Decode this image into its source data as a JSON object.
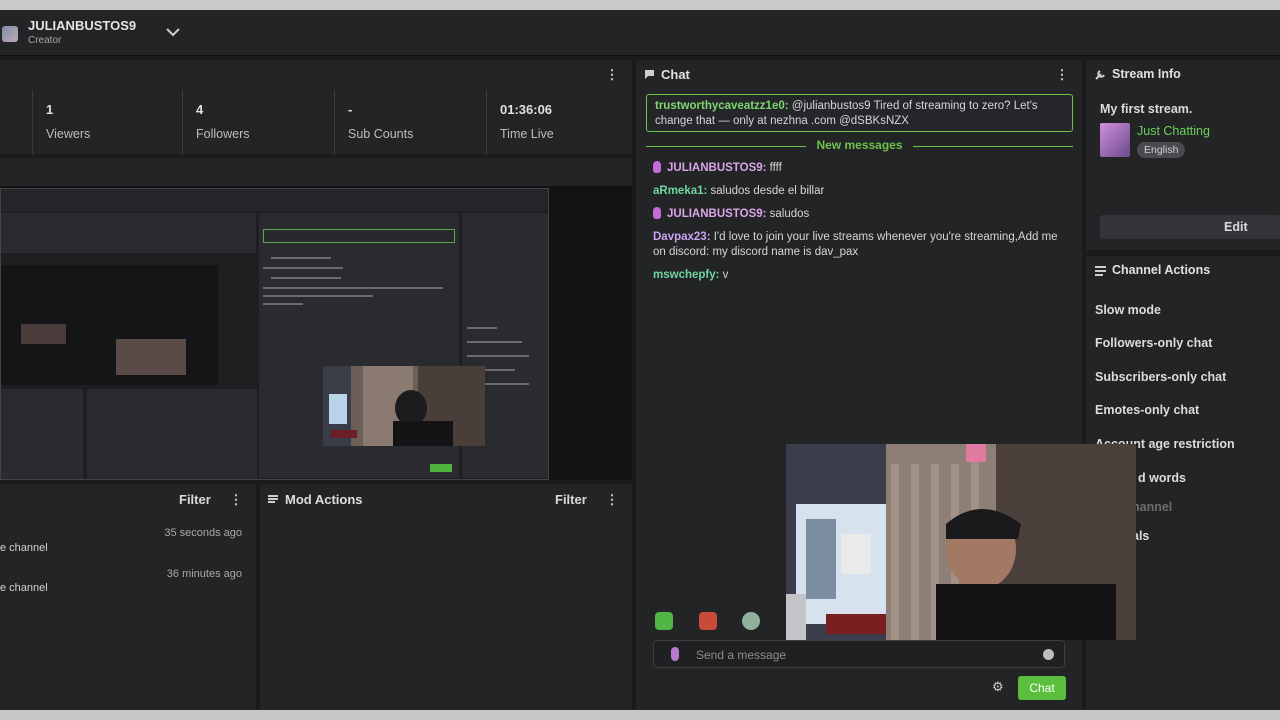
{
  "header": {
    "username": "JULIANBUSTOS9",
    "role": "Creator",
    "icons": {
      "avatar": "channel-avatar",
      "dropdown": "chevron-down-icon"
    }
  },
  "stats": [
    {
      "value": "1",
      "label": "Viewers"
    },
    {
      "value": "4",
      "label": "Followers"
    },
    {
      "value": "-",
      "label": "Sub Counts"
    },
    {
      "value": "01:36:06",
      "label": "Time Live"
    }
  ],
  "activity": {
    "filter_label": "Filter",
    "items": [
      {
        "text": "e channel",
        "time": "35 seconds ago"
      },
      {
        "text": "e channel",
        "time": "36 minutes ago"
      }
    ]
  },
  "mod_actions": {
    "title": "Mod Actions",
    "filter_label": "Filter"
  },
  "chat": {
    "title": "Chat",
    "pinned": {
      "user": "trustworthycaveatzz1e0:",
      "text": " @julianbustos9 Tired of streaming to zero? Let's change that — only at nezhna .com @dSBKsNZX"
    },
    "new_messages_label": "New messages",
    "messages": [
      {
        "user": "JULIANBUSTOS9:",
        "text": " ffff",
        "badge": "mic-badge"
      },
      {
        "user": "aRmeka1:",
        "text": " saludos desde el billar",
        "badge": ""
      },
      {
        "user": "JULIANBUSTOS9:",
        "text": " saludos",
        "badge": "mic-badge"
      },
      {
        "user": "Davpax23:",
        "text": " I'd love to join your live streams whenever you're streaming,Add me on discord: my discord name is dav_pax",
        "badge": ""
      },
      {
        "user": "mswchepfy:",
        "text": " v",
        "badge": ""
      }
    ],
    "send_placeholder": "Send a message",
    "send_button": "Chat"
  },
  "stream_info": {
    "title": "Stream Info",
    "stream_title": "My first stream.",
    "category": "Just Chatting",
    "language": "English",
    "edit_label": "Edit"
  },
  "channel_actions": {
    "title": "Channel Actions",
    "items": [
      "Slow mode",
      "Followers-only chat",
      "Subscribers-only chat",
      "Emotes-only chat",
      "Account age restriction",
      "d words",
      "hannel",
      "als"
    ]
  },
  "colors": {
    "accent": "#5bbf3d",
    "panel": "#232426",
    "background": "#1a1b1d"
  }
}
